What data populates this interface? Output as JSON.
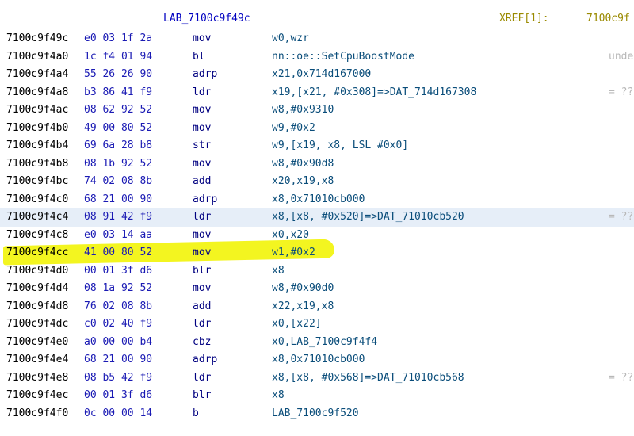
{
  "header": {
    "label": "LAB_7100c9f49c",
    "xref_label": "XREF[1]:",
    "xref_addr": "7100c9f"
  },
  "colors": {
    "highlight": "#f3f520",
    "selected_row": "#e6eef8",
    "address": "#000000",
    "bytes": "#1a1ab4",
    "mnemonic": "#000080",
    "operands": "#0a4d7a",
    "label": "#0000c0",
    "comment": "#b8b8b8"
  },
  "rows": [
    {
      "addr": "7100c9f49c",
      "bytes": "e0 03 1f 2a",
      "mnem": "mov",
      "ops": "w0,wzr",
      "cmt": ""
    },
    {
      "addr": "7100c9f4a0",
      "bytes": "1c f4 01 94",
      "mnem": "bl",
      "ops": "nn::oe::SetCpuBoostMode",
      "cmt": "unde"
    },
    {
      "addr": "7100c9f4a4",
      "bytes": "55 26 26 90",
      "mnem": "adrp",
      "ops": "x21,0x714d167000",
      "cmt": ""
    },
    {
      "addr": "7100c9f4a8",
      "bytes": "b3 86 41 f9",
      "mnem": "ldr",
      "ops": "x19,[x21, #0x308]=>DAT_714d167308",
      "cmt": "= ??"
    },
    {
      "addr": "7100c9f4ac",
      "bytes": "08 62 92 52",
      "mnem": "mov",
      "ops": "w8,#0x9310",
      "cmt": ""
    },
    {
      "addr": "7100c9f4b0",
      "bytes": "49 00 80 52",
      "mnem": "mov",
      "ops": "w9,#0x2",
      "cmt": ""
    },
    {
      "addr": "7100c9f4b4",
      "bytes": "69 6a 28 b8",
      "mnem": "str",
      "ops": "w9,[x19, x8, LSL #0x0]",
      "cmt": ""
    },
    {
      "addr": "7100c9f4b8",
      "bytes": "08 1b 92 52",
      "mnem": "mov",
      "ops": "w8,#0x90d8",
      "cmt": ""
    },
    {
      "addr": "7100c9f4bc",
      "bytes": "74 02 08 8b",
      "mnem": "add",
      "ops": "x20,x19,x8",
      "cmt": ""
    },
    {
      "addr": "7100c9f4c0",
      "bytes": "68 21 00 90",
      "mnem": "adrp",
      "ops": "x8,0x71010cb000",
      "cmt": ""
    },
    {
      "addr": "7100c9f4c4",
      "bytes": "08 91 42 f9",
      "mnem": "ldr",
      "ops": "x8,[x8, #0x520]=>DAT_71010cb520",
      "cmt": "= ??"
    },
    {
      "addr": "7100c9f4c8",
      "bytes": "e0 03 14 aa",
      "mnem": "mov",
      "ops": "x0,x20",
      "cmt": ""
    },
    {
      "addr": "7100c9f4cc",
      "bytes": "41 00 80 52",
      "mnem": "mov",
      "ops": "w1,#0x2",
      "cmt": ""
    },
    {
      "addr": "7100c9f4d0",
      "bytes": "00 01 3f d6",
      "mnem": "blr",
      "ops": "x8",
      "cmt": ""
    },
    {
      "addr": "7100c9f4d4",
      "bytes": "08 1a 92 52",
      "mnem": "mov",
      "ops": "w8,#0x90d0",
      "cmt": ""
    },
    {
      "addr": "7100c9f4d8",
      "bytes": "76 02 08 8b",
      "mnem": "add",
      "ops": "x22,x19,x8",
      "cmt": ""
    },
    {
      "addr": "7100c9f4dc",
      "bytes": "c0 02 40 f9",
      "mnem": "ldr",
      "ops": "x0,[x22]",
      "cmt": ""
    },
    {
      "addr": "7100c9f4e0",
      "bytes": "a0 00 00 b4",
      "mnem": "cbz",
      "ops": "x0,LAB_7100c9f4f4",
      "cmt": ""
    },
    {
      "addr": "7100c9f4e4",
      "bytes": "68 21 00 90",
      "mnem": "adrp",
      "ops": "x8,0x71010cb000",
      "cmt": ""
    },
    {
      "addr": "7100c9f4e8",
      "bytes": "08 b5 42 f9",
      "mnem": "ldr",
      "ops": "x8,[x8, #0x568]=>DAT_71010cb568",
      "cmt": "= ??"
    },
    {
      "addr": "7100c9f4ec",
      "bytes": "00 01 3f d6",
      "mnem": "blr",
      "ops": "x8",
      "cmt": ""
    },
    {
      "addr": "7100c9f4f0",
      "bytes": "0c 00 00 14",
      "mnem": "b",
      "ops": "LAB_7100c9f520",
      "cmt": ""
    }
  ]
}
